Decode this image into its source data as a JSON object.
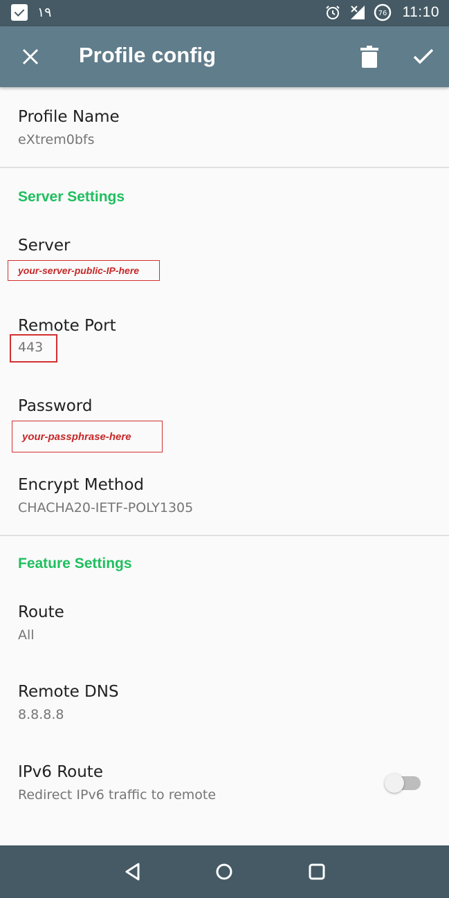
{
  "status_bar": {
    "notification_text": "١٩",
    "clock": "11:10",
    "data_saver_badge": "76"
  },
  "app_bar": {
    "title": "Profile config"
  },
  "profile_name": {
    "title": "Profile Name",
    "summary": "eXtrem0bfs"
  },
  "server_settings": {
    "header": "Server Settings",
    "server": {
      "title": "Server",
      "summary": "your-server-public-IP-here"
    },
    "remote_port": {
      "title": "Remote Port",
      "summary": "443"
    },
    "password": {
      "title": "Password",
      "summary": "your-passphrase-here"
    },
    "encrypt_method": {
      "title": "Encrypt Method",
      "summary": "CHACHA20-IETF-POLY1305"
    }
  },
  "feature_settings": {
    "header": "Feature Settings",
    "route": {
      "title": "Route",
      "summary": "All"
    },
    "remote_dns": {
      "title": "Remote DNS",
      "summary": "8.8.8.8"
    },
    "ipv6_route": {
      "title": "IPv6 Route",
      "summary": "Redirect IPv6 traffic to remote",
      "enabled": false
    }
  },
  "colors": {
    "status_bar": "#455a64",
    "app_bar": "#607d8b",
    "category_accent": "#1fbf5e",
    "annotation_red": "#d32f2f"
  }
}
